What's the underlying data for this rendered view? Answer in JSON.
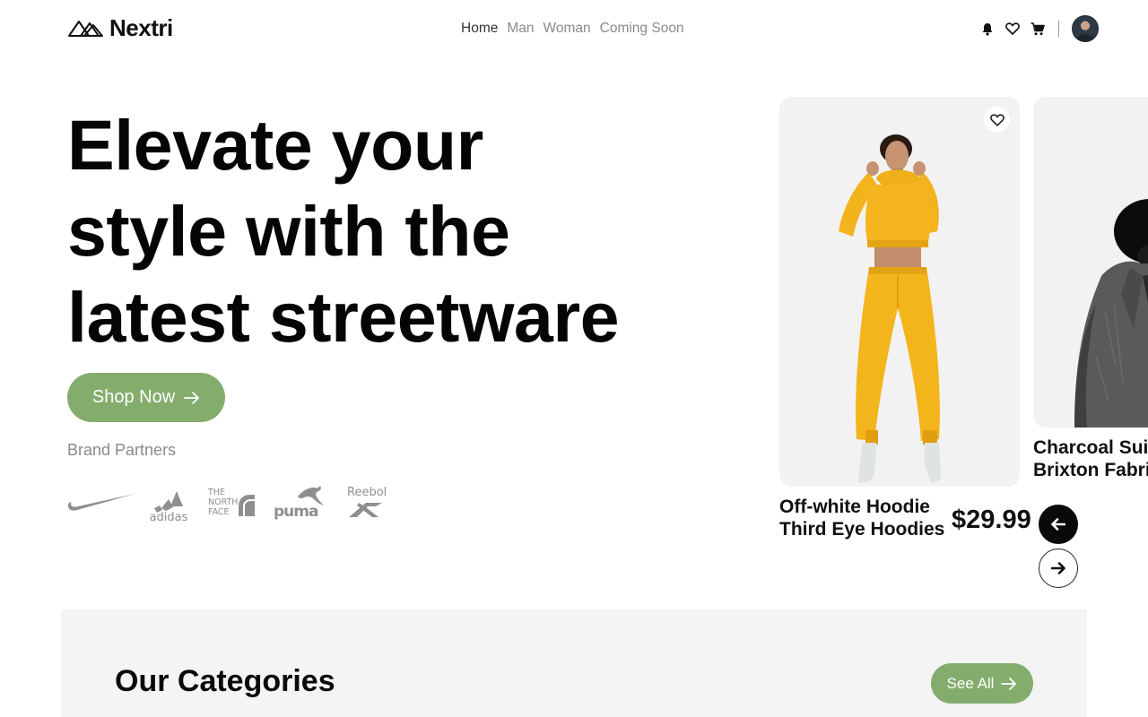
{
  "header": {
    "brand_name": "Nextri",
    "nav": [
      {
        "label": "Home",
        "active": true
      },
      {
        "label": "Man",
        "active": false
      },
      {
        "label": "Woman",
        "active": false
      },
      {
        "label": "Coming Soon",
        "active": false
      }
    ],
    "icons": [
      "bell-icon",
      "heart-icon",
      "cart-icon",
      "avatar"
    ]
  },
  "hero": {
    "title_lines": [
      "Elevate your",
      "style with the",
      "latest streetware"
    ],
    "cta_label": "Shop Now",
    "partners_label": "Brand Partners",
    "brands": [
      "Nike",
      "adidas",
      "THE NORTH FACE",
      "PUMA",
      "Reebok"
    ]
  },
  "products": [
    {
      "name_line1": "Off-white Hoodie",
      "name_line2": "Third Eye Hoodies",
      "price": "$29.99"
    },
    {
      "name_line1": "Charcoal Suit",
      "name_line2": "Brixton Fabric"
    }
  ],
  "categories": {
    "title": "Our Categories",
    "see_all_label": "See All"
  },
  "colors": {
    "accent": "#84ad6d",
    "text": "#111111",
    "muted": "#8a8a8a",
    "card_bg": "#f2f2f2",
    "section_bg": "#f4f4f4",
    "hoodie_yellow": "#f3b51c"
  }
}
